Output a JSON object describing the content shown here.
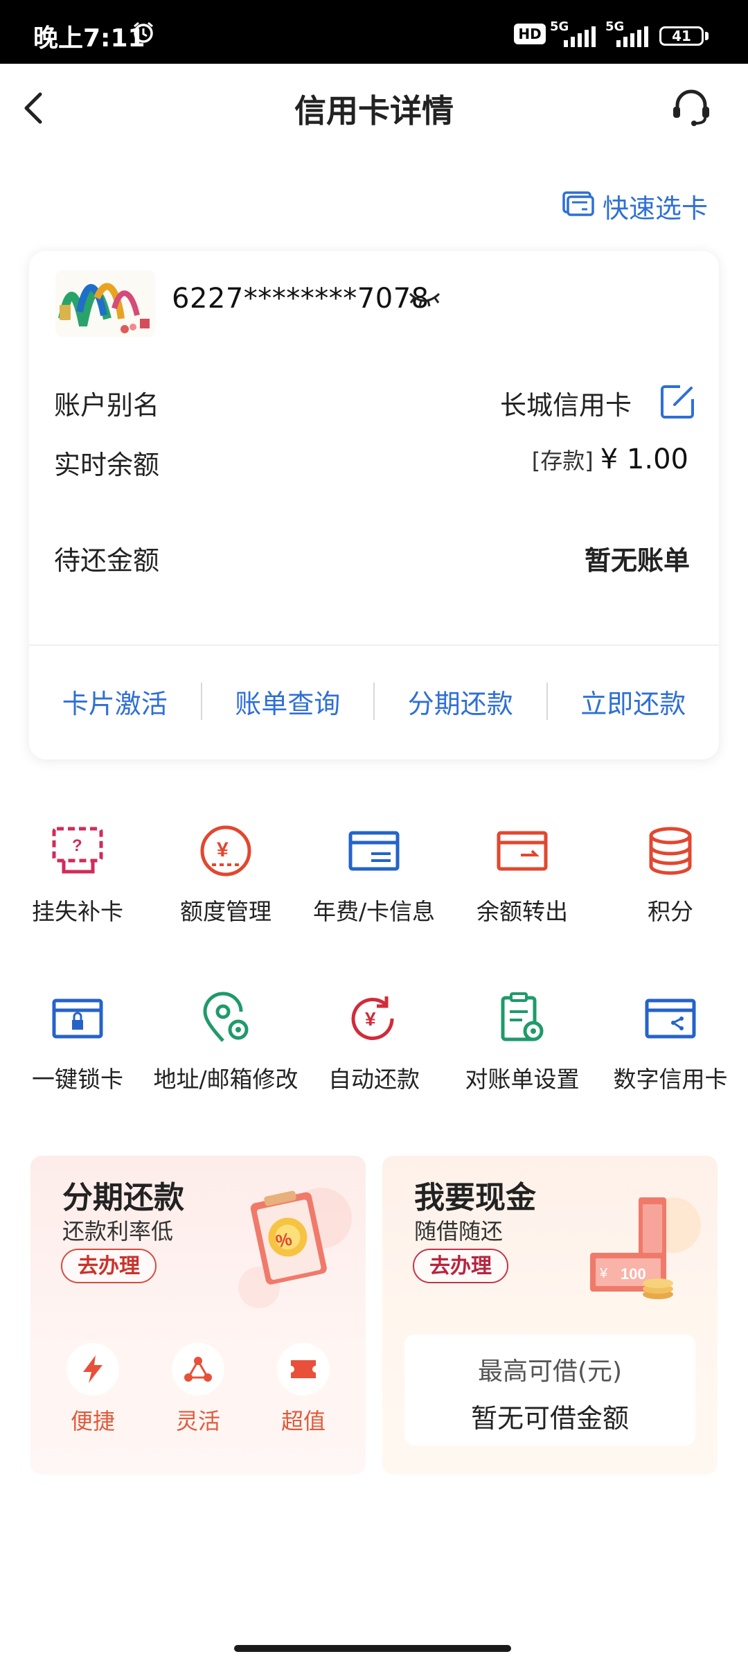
{
  "status_bar": {
    "time": "晚上7:11",
    "hd": "HD",
    "net1": "5G",
    "net2": "5G",
    "battery": "41"
  },
  "header": {
    "title": "信用卡详情"
  },
  "quick_select": {
    "label": "快速选卡"
  },
  "card": {
    "number": "6227********7078",
    "rows": [
      {
        "label": "账户别名",
        "value": "长城信用卡"
      },
      {
        "label": "实时余额",
        "prefix": "[存款]",
        "value": "¥ 1.00"
      },
      {
        "label": "待还金额",
        "value": "暂无账单"
      }
    ],
    "actions": [
      "卡片激活",
      "账单查询",
      "分期还款",
      "立即还款"
    ]
  },
  "grid": [
    {
      "label": "挂失补卡",
      "icon": "report-loss-icon"
    },
    {
      "label": "额度管理",
      "icon": "credit-limit-icon"
    },
    {
      "label": "年费/卡信息",
      "icon": "card-info-icon"
    },
    {
      "label": "余额转出",
      "icon": "balance-transfer-icon"
    },
    {
      "label": "积分",
      "icon": "points-icon"
    },
    {
      "label": "一键锁卡",
      "icon": "lock-card-icon"
    },
    {
      "label": "地址/邮箱修改",
      "icon": "address-edit-icon"
    },
    {
      "label": "自动还款",
      "icon": "auto-repay-icon"
    },
    {
      "label": "对账单设置",
      "icon": "statement-settings-icon"
    },
    {
      "label": "数字信用卡",
      "icon": "digital-card-icon"
    }
  ],
  "promo_installment": {
    "title": "分期还款",
    "subtitle": "还款利率低",
    "button": "去办理",
    "features": [
      "便捷",
      "灵活",
      "超值"
    ]
  },
  "promo_cash": {
    "title": "我要现金",
    "subtitle": "随借随还",
    "button": "去办理",
    "max_label": "最高可借(元)",
    "max_value": "暂无可借金额"
  },
  "colors": {
    "accent_blue": "#2f6fd6",
    "accent_red": "#e2472f",
    "accent_green": "#1f9a6a"
  }
}
